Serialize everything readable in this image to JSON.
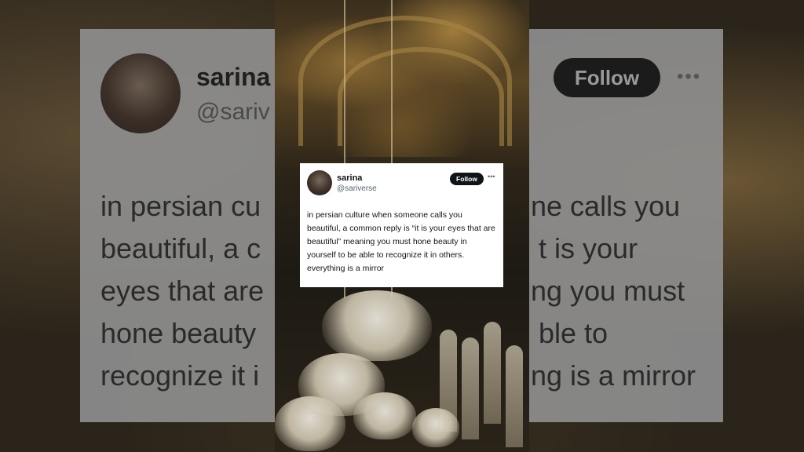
{
  "background_tweet": {
    "name": "sarina",
    "handle": "@sariv",
    "follow_label": "Follow",
    "more_icon": "•••",
    "lines": [
      "in persian cu",
      "beautiful, a c",
      "eyes that are",
      "hone beauty",
      "recognize it i"
    ],
    "right_lines": [
      "ne calls you",
      "t is your",
      "ng you must",
      "ble to",
      "ng is a mirror"
    ]
  },
  "tweet": {
    "name": "sarina",
    "handle": "@sariverse",
    "follow_label": "Follow",
    "more_icon": "•••",
    "text": "in persian culture when someone calls you beautiful, a common reply is “it is your eyes that are beautiful” meaning you must hone beauty in yourself to be able to recognize it in others. everything is a mirror"
  },
  "colors": {
    "follow_bg": "#0f1419",
    "handle": "#536471"
  }
}
